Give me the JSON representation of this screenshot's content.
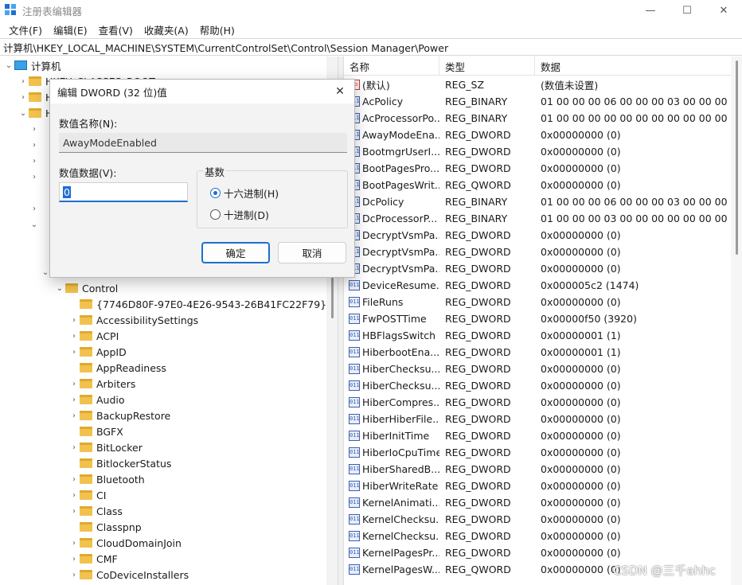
{
  "window": {
    "title": "注册表编辑器",
    "min_glyph": "—",
    "max_glyph": "☐",
    "close_glyph": "✕"
  },
  "menu": [
    "文件(F)",
    "编辑(E)",
    "查看(V)",
    "收藏夹(A)",
    "帮助(H)"
  ],
  "address": "计算机\\HKEY_LOCAL_MACHINE\\SYSTEM\\CurrentControlSet\\Control\\Session Manager\\Power",
  "tree": {
    "root": "计算机",
    "hives_visible": [
      {
        "label": "HKEY_CLASSES_ROOT"
      },
      {
        "label": "H"
      },
      {
        "label": "H"
      }
    ],
    "control_label": "Control",
    "children": [
      "{7746D80F-97E0-4E26-9543-26B41FC22F79}",
      "AccessibilitySettings",
      "ACPI",
      "AppID",
      "AppReadiness",
      "Arbiters",
      "Audio",
      "BackupRestore",
      "BGFX",
      "BitLocker",
      "BitlockerStatus",
      "Bluetooth",
      "CI",
      "Class",
      "Classpnp",
      "CloudDomainJoin",
      "CMF",
      "CoDeviceInstallers"
    ]
  },
  "list": {
    "headers": {
      "name": "名称",
      "type": "类型",
      "data": "数据"
    },
    "rows": [
      {
        "name": "(默认)",
        "type": "REG_SZ",
        "data": "(数值未设置)",
        "icon": "ab"
      },
      {
        "name": "AcPolicy",
        "type": "REG_BINARY",
        "data": "01 00 00 00 06 00 00 00 03 00 00 00 00 0",
        "icon": "bin"
      },
      {
        "name": "AcProcessorPo...",
        "type": "REG_BINARY",
        "data": "01 00 00 00 00 00 00 00 00 00 00 00 03 0",
        "icon": "bin"
      },
      {
        "name": "AwayModeEna...",
        "type": "REG_DWORD",
        "data": "0x00000000 (0)",
        "icon": "bin"
      },
      {
        "name": "BootmgrUserI...",
        "type": "REG_DWORD",
        "data": "0x00000000 (0)",
        "icon": "bin"
      },
      {
        "name": "BootPagesPro...",
        "type": "REG_DWORD",
        "data": "0x00000000 (0)",
        "icon": "bin"
      },
      {
        "name": "BootPagesWrit...",
        "type": "REG_QWORD",
        "data": "0x00000000 (0)",
        "icon": "bin"
      },
      {
        "name": "DcPolicy",
        "type": "REG_BINARY",
        "data": "01 00 00 00 06 00 00 00 03 00 00 00 00 0",
        "icon": "bin"
      },
      {
        "name": "DcProcessorP...",
        "type": "REG_BINARY",
        "data": "01 00 00 00 03 00 00 00 00 00 00 00 03 0",
        "icon": "bin"
      },
      {
        "name": "DecryptVsmPa...",
        "type": "REG_DWORD",
        "data": "0x00000000 (0)",
        "icon": "bin"
      },
      {
        "name": "DecryptVsmPa...",
        "type": "REG_DWORD",
        "data": "0x00000000 (0)",
        "icon": "bin"
      },
      {
        "name": "DecryptVsmPa...",
        "type": "REG_DWORD",
        "data": "0x00000000 (0)",
        "icon": "bin"
      },
      {
        "name": "DeviceResume...",
        "type": "REG_DWORD",
        "data": "0x000005c2 (1474)",
        "icon": "bin"
      },
      {
        "name": "FileRuns",
        "type": "REG_DWORD",
        "data": "0x00000000 (0)",
        "icon": "bin"
      },
      {
        "name": "FwPOSTTime",
        "type": "REG_DWORD",
        "data": "0x00000f50 (3920)",
        "icon": "bin"
      },
      {
        "name": "HBFlagsSwitch",
        "type": "REG_DWORD",
        "data": "0x00000001 (1)",
        "icon": "bin"
      },
      {
        "name": "HiberbootEna...",
        "type": "REG_DWORD",
        "data": "0x00000001 (1)",
        "icon": "bin"
      },
      {
        "name": "HiberChecksu...",
        "type": "REG_DWORD",
        "data": "0x00000000 (0)",
        "icon": "bin"
      },
      {
        "name": "HiberChecksu...",
        "type": "REG_DWORD",
        "data": "0x00000000 (0)",
        "icon": "bin"
      },
      {
        "name": "HiberCompres...",
        "type": "REG_DWORD",
        "data": "0x00000000 (0)",
        "icon": "bin"
      },
      {
        "name": "HiberHiberFile...",
        "type": "REG_DWORD",
        "data": "0x00000000 (0)",
        "icon": "bin"
      },
      {
        "name": "HiberInitTime",
        "type": "REG_DWORD",
        "data": "0x00000000 (0)",
        "icon": "bin"
      },
      {
        "name": "HiberIoCpuTime",
        "type": "REG_DWORD",
        "data": "0x00000000 (0)",
        "icon": "bin"
      },
      {
        "name": "HiberSharedB...",
        "type": "REG_DWORD",
        "data": "0x00000000 (0)",
        "icon": "bin"
      },
      {
        "name": "HiberWriteRate",
        "type": "REG_DWORD",
        "data": "0x00000000 (0)",
        "icon": "bin"
      },
      {
        "name": "KernelAnimati...",
        "type": "REG_DWORD",
        "data": "0x00000000 (0)",
        "icon": "bin"
      },
      {
        "name": "KernelChecksu...",
        "type": "REG_DWORD",
        "data": "0x00000000 (0)",
        "icon": "bin"
      },
      {
        "name": "KernelChecksu...",
        "type": "REG_DWORD",
        "data": "0x00000000 (0)",
        "icon": "bin"
      },
      {
        "name": "KernelPagesPr...",
        "type": "REG_DWORD",
        "data": "0x00000000 (0)",
        "icon": "bin"
      },
      {
        "name": "KernelPagesW...",
        "type": "REG_QWORD",
        "data": "0x00000000 (0)",
        "icon": "bin"
      }
    ]
  },
  "dialog": {
    "title": "编辑 DWORD (32 位)值",
    "close_glyph": "✕",
    "name_label": "数值名称(N):",
    "name_value": "AwayModeEnabled",
    "data_label": "数值数据(V):",
    "data_value": "0",
    "base_label": "基数",
    "radio_hex": "十六进制(H)",
    "radio_dec": "十进制(D)",
    "selected_base": "hex",
    "ok_label": "确定",
    "cancel_label": "取消"
  },
  "watermark": "CSDN @三千ahhc",
  "colors": {
    "accent": "#1e6fd0",
    "folder": "#f2c14e"
  }
}
